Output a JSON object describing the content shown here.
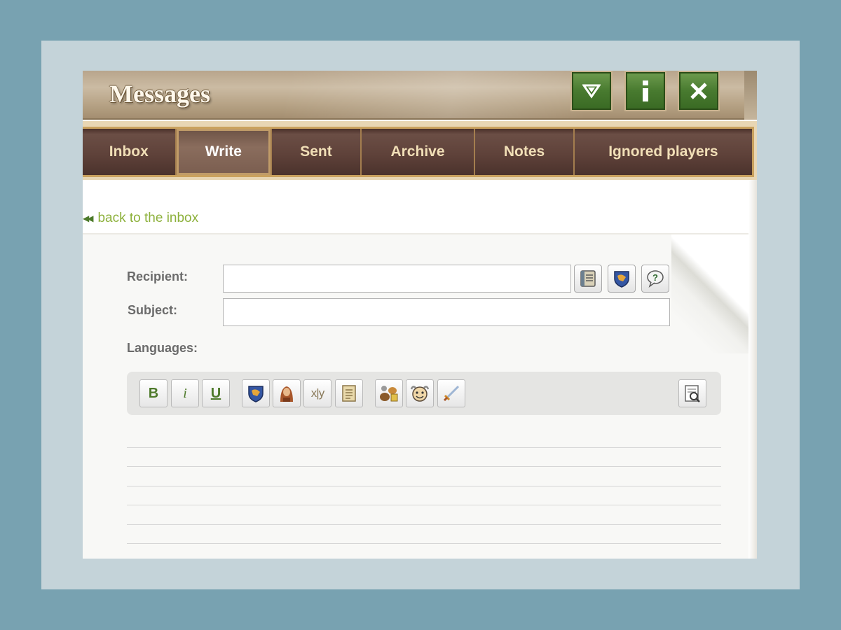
{
  "window": {
    "title": "Messages",
    "buttons": [
      "collapse-icon",
      "info-icon",
      "close-icon"
    ]
  },
  "tabs": [
    {
      "label": "Inbox",
      "active": false
    },
    {
      "label": "Write",
      "active": true
    },
    {
      "label": "Sent",
      "active": false
    },
    {
      "label": "Archive",
      "active": false
    },
    {
      "label": "Notes",
      "active": false
    },
    {
      "label": "Ignored players",
      "active": false
    }
  ],
  "back_link": "back to the inbox",
  "form": {
    "recipient_label": "Recipient:",
    "recipient_value": "",
    "subject_label": "Subject:",
    "subject_value": "",
    "languages_label": "Languages:"
  },
  "toolbar": {
    "bold": "B",
    "italic": "i",
    "underline": "U",
    "coords": "x|y"
  },
  "colors": {
    "accent_green": "#487a2f",
    "link_green": "#8db13c",
    "tab_brown": "#5f423a",
    "tab_text": "#f1dfb7"
  }
}
